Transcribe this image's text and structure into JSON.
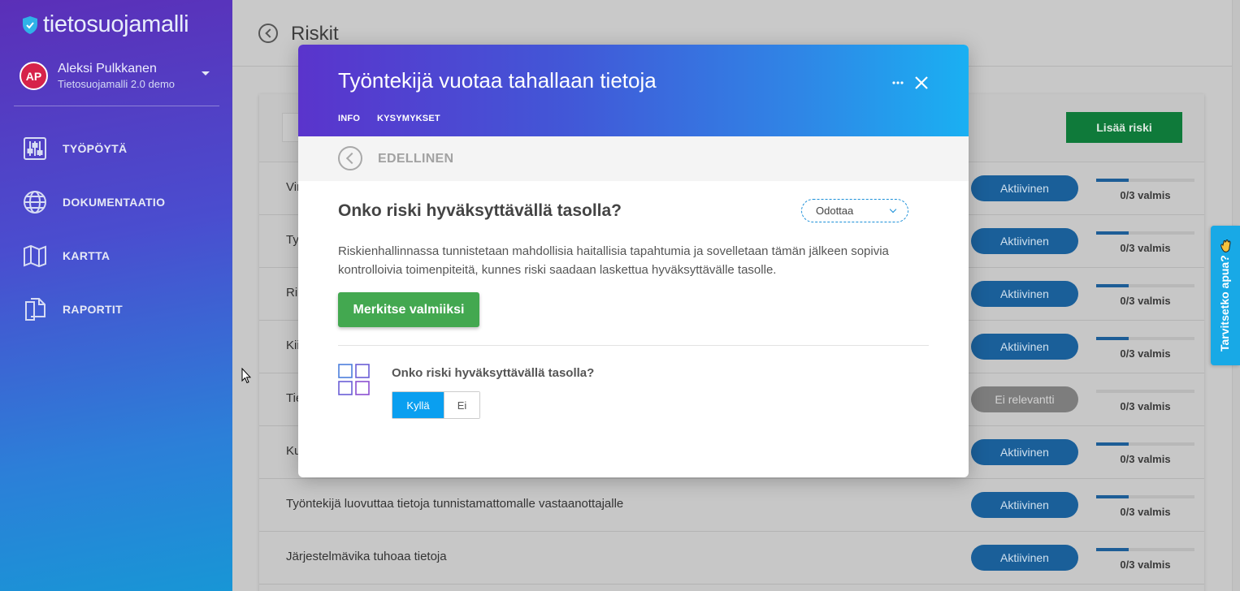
{
  "sidebar": {
    "logo_text": "tietosuojamalli",
    "user": {
      "initials": "AP",
      "name": "Aleksi Pulkkanen",
      "org": "Tietosuojamalli 2.0 demo"
    },
    "nav": [
      {
        "label": "TYÖPÖYTÄ",
        "icon": "sliders-icon"
      },
      {
        "label": "DOKUMENTAATIO",
        "icon": "globe-icon"
      },
      {
        "label": "KARTTA",
        "icon": "map-icon"
      },
      {
        "label": "RAPORTIT",
        "icon": "documents-icon"
      }
    ]
  },
  "main": {
    "page_title": "Riskit",
    "add_button": "Lisää riski",
    "rows": [
      {
        "name": "Vir",
        "status": "Aktiivinen",
        "progress": "0/3 valmis",
        "fill": 0.33
      },
      {
        "name": "Ty",
        "status": "Aktiivinen",
        "progress": "0/3 valmis",
        "fill": 0.33
      },
      {
        "name": "Rii",
        "status": "Aktiivinen",
        "progress": "0/3 valmis",
        "fill": 0.33
      },
      {
        "name": "Kii",
        "status": "Aktiivinen",
        "progress": "0/3 valmis",
        "fill": 0.33
      },
      {
        "name": "Tie",
        "status": "Ei relevantti",
        "progress": "0/3 valmis",
        "fill": 0
      },
      {
        "name": "Ku",
        "status": "Aktiivinen",
        "progress": "0/3 valmis",
        "fill": 0.33
      },
      {
        "name": "Työntekijä luovuttaa tietoja tunnistamattomalle vastaanottajalle",
        "status": "Aktiivinen",
        "progress": "0/3 valmis",
        "fill": 0.33
      },
      {
        "name": "Järjestelmävika tuhoaa tietoja",
        "status": "Aktiivinen",
        "progress": "0/3 valmis",
        "fill": 0.33
      }
    ]
  },
  "help_tab": {
    "label": "Tarvitsetko apua?"
  },
  "modal": {
    "title": "Työntekijä vuotaa tahallaan tietoja",
    "tabs": [
      "INFO",
      "KYSYMYKSET"
    ],
    "prev_label": "EDELLINEN",
    "question": "Onko riski hyväksyttävällä tasolla?",
    "status_select": "Odottaa",
    "description": "Riskienhallinnassa tunnistetaan mahdollisia haitallisia tapahtumia ja sovelletaan tämän jälkeen sopivia kontrolloivia toimenpiteitä, kunnes riski saadaan laskettua hyväksyttävälle tasolle.",
    "done_button": "Merkitse valmiiksi",
    "sub_question": "Onko riski hyväksyttävällä tasolla?",
    "toggle": {
      "yes": "Kyllä",
      "no": "Ei",
      "selected": "Kyllä"
    }
  },
  "colors": {
    "accent_green": "#43a850",
    "accent_blue": "#0a9ff0",
    "status_active": "#1a5f99"
  }
}
